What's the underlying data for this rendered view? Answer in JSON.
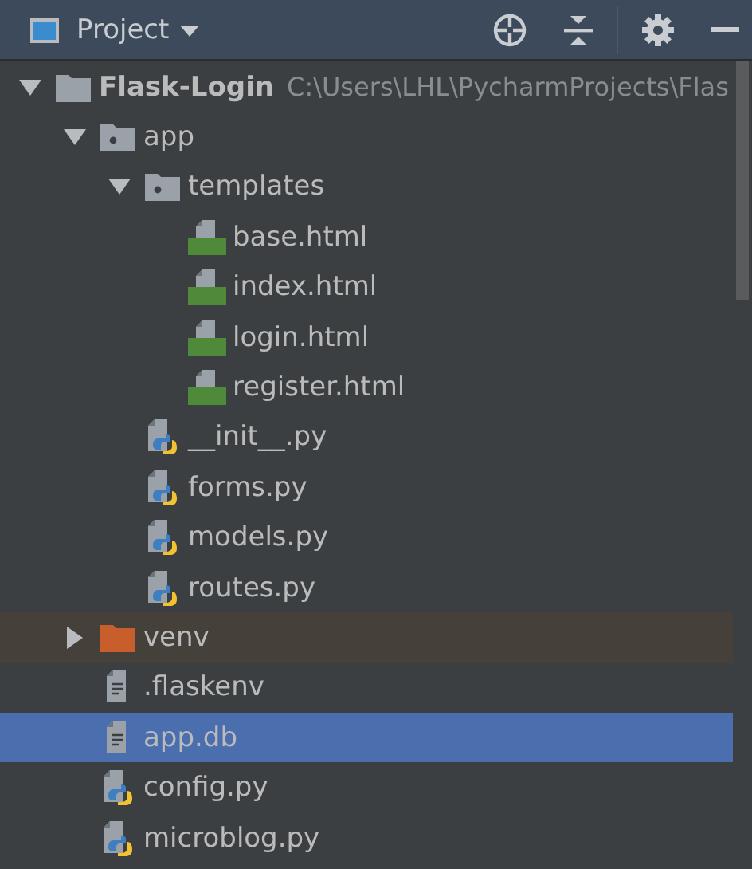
{
  "panel": {
    "title": "Project"
  },
  "tree": [
    {
      "label": "Flask-Login",
      "path": "C:\\Users\\LHL\\PycharmProjects\\Flas",
      "kind": "project",
      "expanded": true,
      "selected": false,
      "children": [
        {
          "label": "app",
          "kind": "package",
          "expanded": true,
          "selected": false,
          "children": [
            {
              "label": "templates",
              "kind": "package",
              "expanded": true,
              "selected": false,
              "children": [
                {
                  "label": "base.html",
                  "kind": "html",
                  "selected": false
                },
                {
                  "label": "index.html",
                  "kind": "html",
                  "selected": false
                },
                {
                  "label": "login.html",
                  "kind": "html",
                  "selected": false
                },
                {
                  "label": "register.html",
                  "kind": "html",
                  "selected": false
                }
              ]
            },
            {
              "label": "__init__.py",
              "kind": "python",
              "selected": false
            },
            {
              "label": "forms.py",
              "kind": "python",
              "selected": false
            },
            {
              "label": "models.py",
              "kind": "python",
              "selected": false
            },
            {
              "label": "routes.py",
              "kind": "python",
              "selected": false
            }
          ]
        },
        {
          "label": "venv",
          "kind": "excluded",
          "expanded": false,
          "selected": false
        },
        {
          "label": ".flaskenv",
          "kind": "text",
          "selected": false
        },
        {
          "label": "app.db",
          "kind": "text",
          "selected": true
        },
        {
          "label": "config.py",
          "kind": "python",
          "selected": false
        },
        {
          "label": "microblog.py",
          "kind": "python",
          "selected": false
        }
      ]
    }
  ]
}
